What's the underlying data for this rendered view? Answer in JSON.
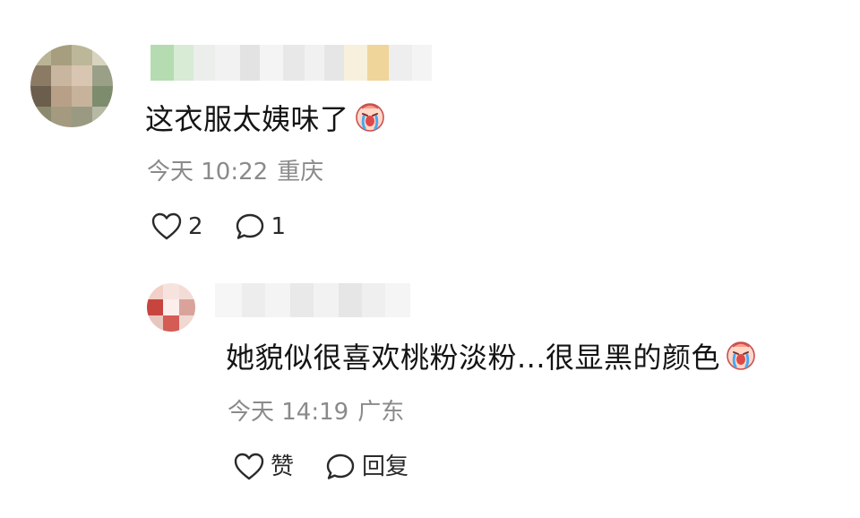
{
  "comments": [
    {
      "text": "这衣服太姨味了",
      "emoji": "crying-emoji",
      "time": "今天 10:22",
      "location": "重庆",
      "likes": "2",
      "replies": "1"
    },
    {
      "text": "她貌似很喜欢桃粉淡粉...很显黑的颜色",
      "emoji": "crying-emoji",
      "time": "今天 14:19",
      "location": "广东",
      "like_label": "赞",
      "reply_label": "回复"
    }
  ],
  "colors": {
    "meta_text": "#8a8a8a",
    "main_text": "#141414",
    "icon_stroke": "#2a2a2a"
  },
  "icons": {
    "like": "heart-outline-icon",
    "reply": "speech-bubble-outline-icon",
    "reaction": "crying-face-emoji"
  }
}
